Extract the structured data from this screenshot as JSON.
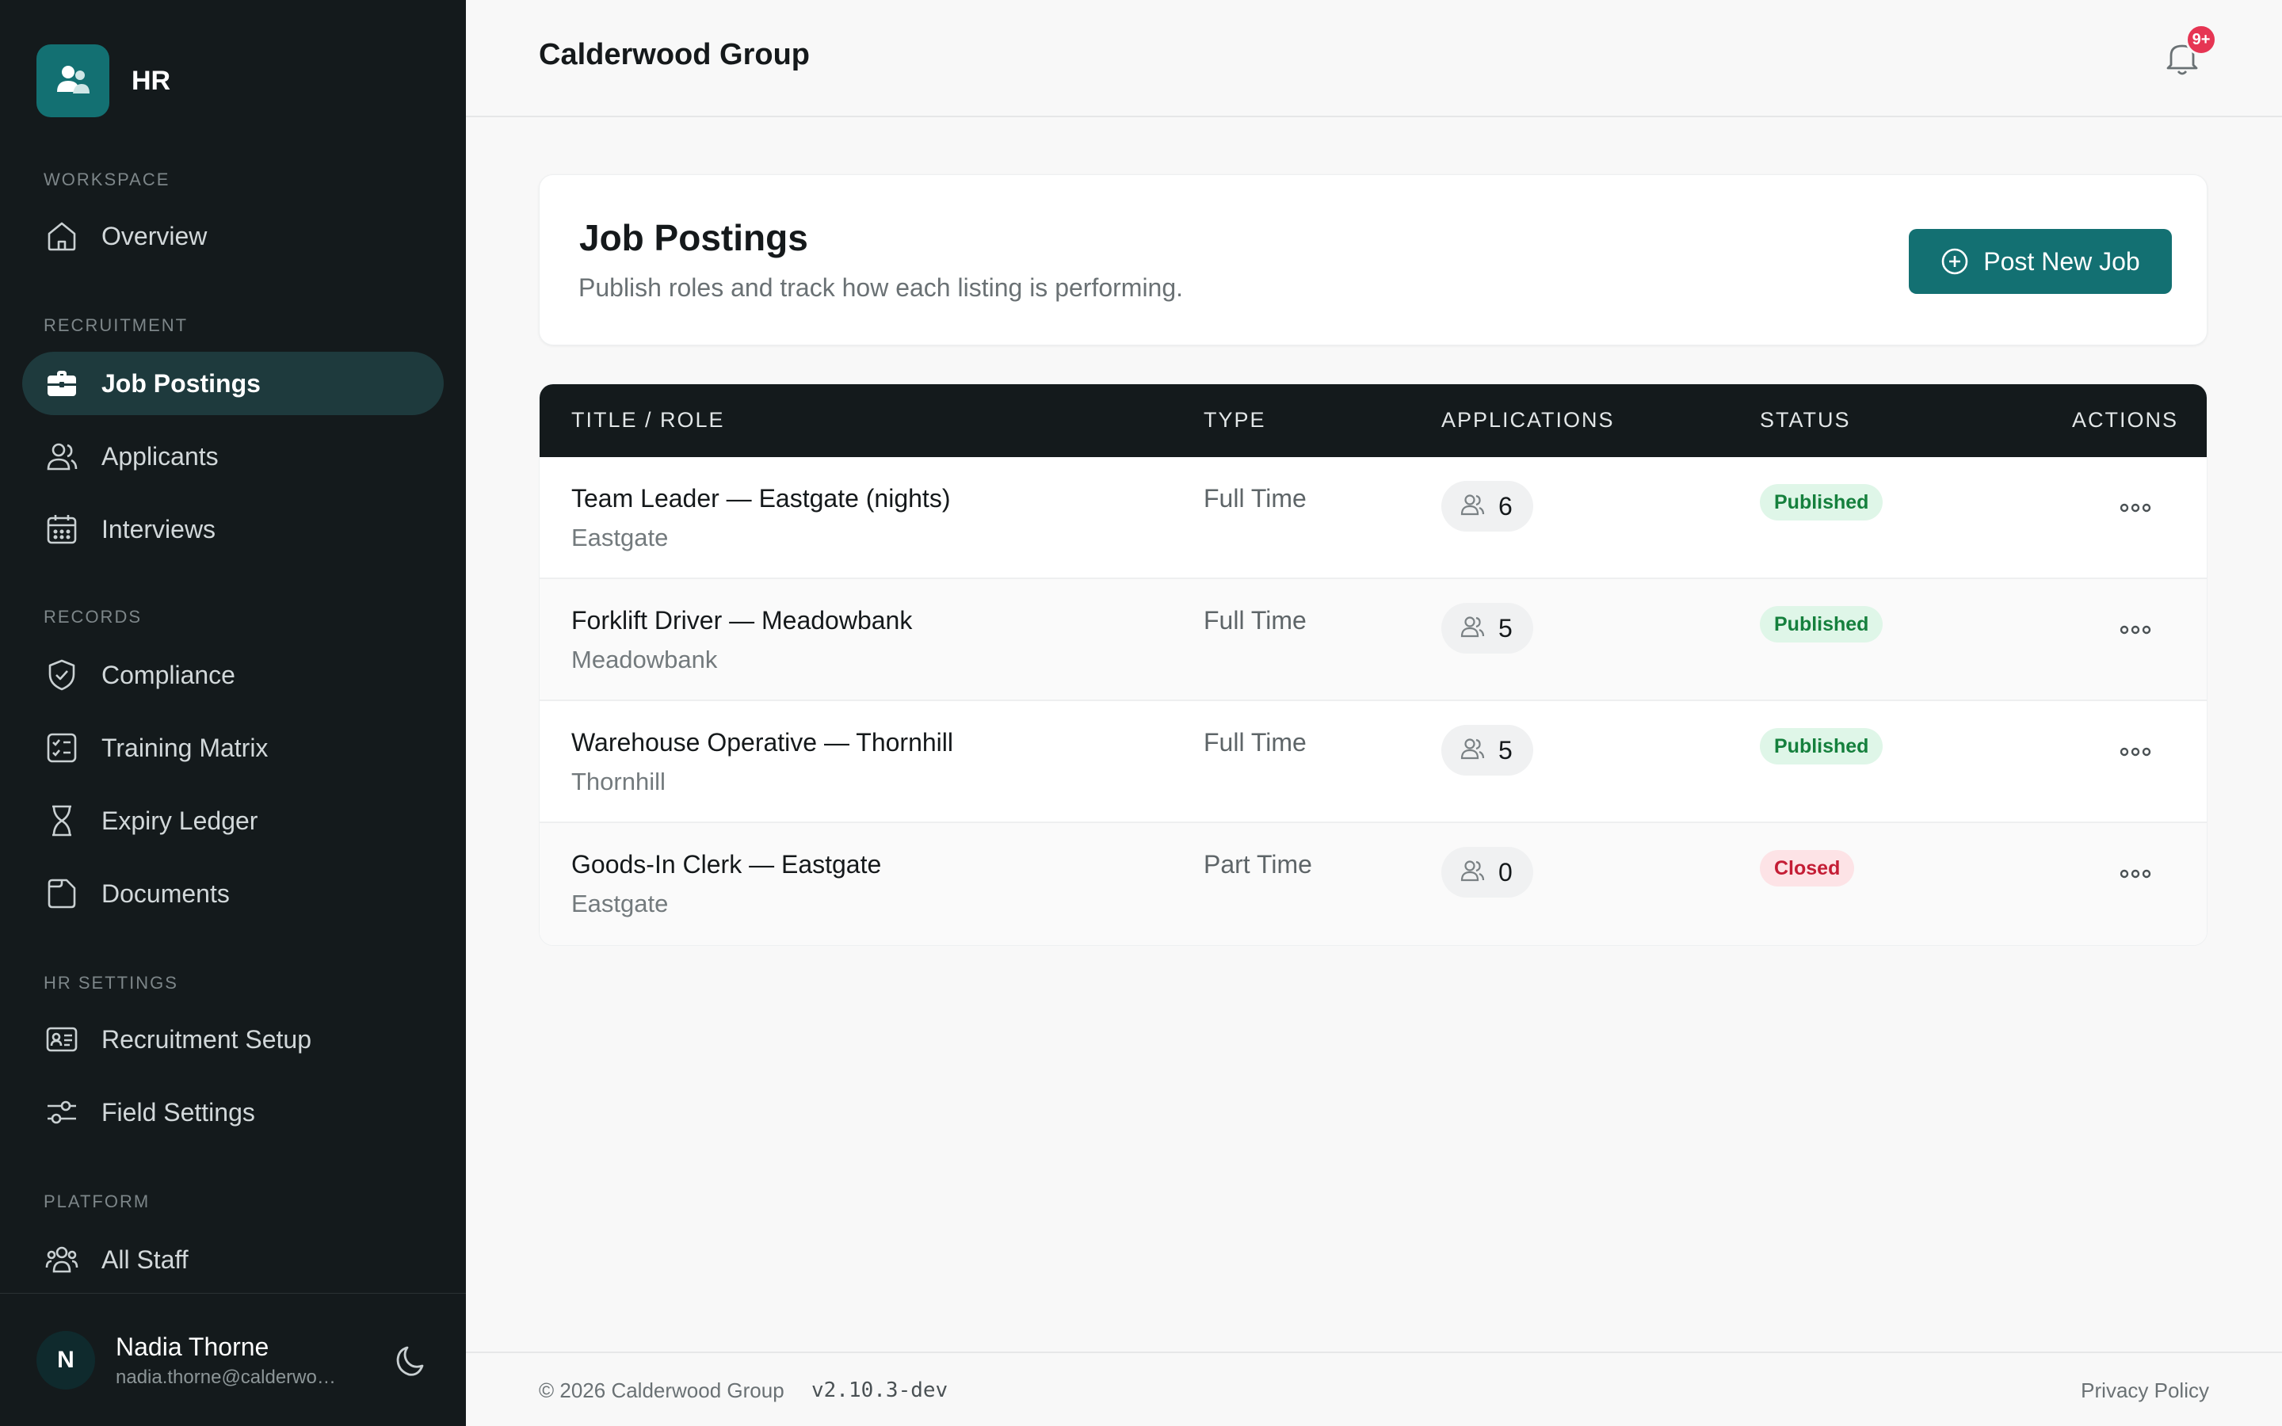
{
  "brand": {
    "name": "HR",
    "icon": "users-icon",
    "color": "#137072"
  },
  "sidebar": {
    "sections": {
      "workspace": "WORKSPACE",
      "recruitment": "RECRUITMENT",
      "records": "RECORDS",
      "hr_settings": "HR SETTINGS",
      "platform": "PLATFORM"
    },
    "items": [
      {
        "label": "Overview",
        "icon": "home-icon"
      },
      {
        "label": "Job Postings",
        "icon": "briefcase-icon",
        "active": true
      },
      {
        "label": "Applicants",
        "icon": "users-icon"
      },
      {
        "label": "Interviews",
        "icon": "calendar-icon"
      },
      {
        "label": "Compliance",
        "icon": "shield-check-icon"
      },
      {
        "label": "Training Matrix",
        "icon": "checklist-icon"
      },
      {
        "label": "Expiry Ledger",
        "icon": "hourglass-icon"
      },
      {
        "label": "Documents",
        "icon": "document-icon"
      },
      {
        "label": "Recruitment Setup",
        "icon": "id-card-icon"
      },
      {
        "label": "Field Settings",
        "icon": "sliders-icon"
      },
      {
        "label": "All Staff",
        "icon": "group-icon"
      }
    ],
    "user": {
      "initial": "N",
      "name": "Nadia Thorne",
      "email": "nadia.thorne@calderwood.co"
    }
  },
  "header": {
    "org": "Calderwood Group",
    "notifications": "9+"
  },
  "page": {
    "title": "Job Postings",
    "subtitle": "Publish roles and track how each listing is performing.",
    "post_button": "Post New Job"
  },
  "table": {
    "columns": {
      "title": "TITLE / ROLE",
      "type": "TYPE",
      "applications": "APPLICATIONS",
      "status": "STATUS",
      "actions": "ACTIONS"
    },
    "rows": [
      {
        "title": "Team Leader — Eastgate (nights)",
        "location": "Eastgate",
        "type": "Full Time",
        "applications": "6",
        "status": "Published"
      },
      {
        "title": "Forklift Driver — Meadowbank",
        "location": "Meadowbank",
        "type": "Full Time",
        "applications": "5",
        "status": "Published"
      },
      {
        "title": "Warehouse Operative — Thornhill",
        "location": "Thornhill",
        "type": "Full Time",
        "applications": "5",
        "status": "Published"
      },
      {
        "title": "Goods-In Clerk — Eastgate",
        "location": "Eastgate",
        "type": "Part Time",
        "applications": "0",
        "status": "Closed"
      }
    ]
  },
  "footer": {
    "copyright": "© 2026 Calderwood Group",
    "version": "v2.10.3-dev",
    "privacy": "Privacy Policy"
  },
  "colors": {
    "accent": "#137072",
    "sidebar_bg": "#141a1c",
    "published": "#15803d",
    "closed": "#c41d35",
    "badge": "#e63553"
  }
}
